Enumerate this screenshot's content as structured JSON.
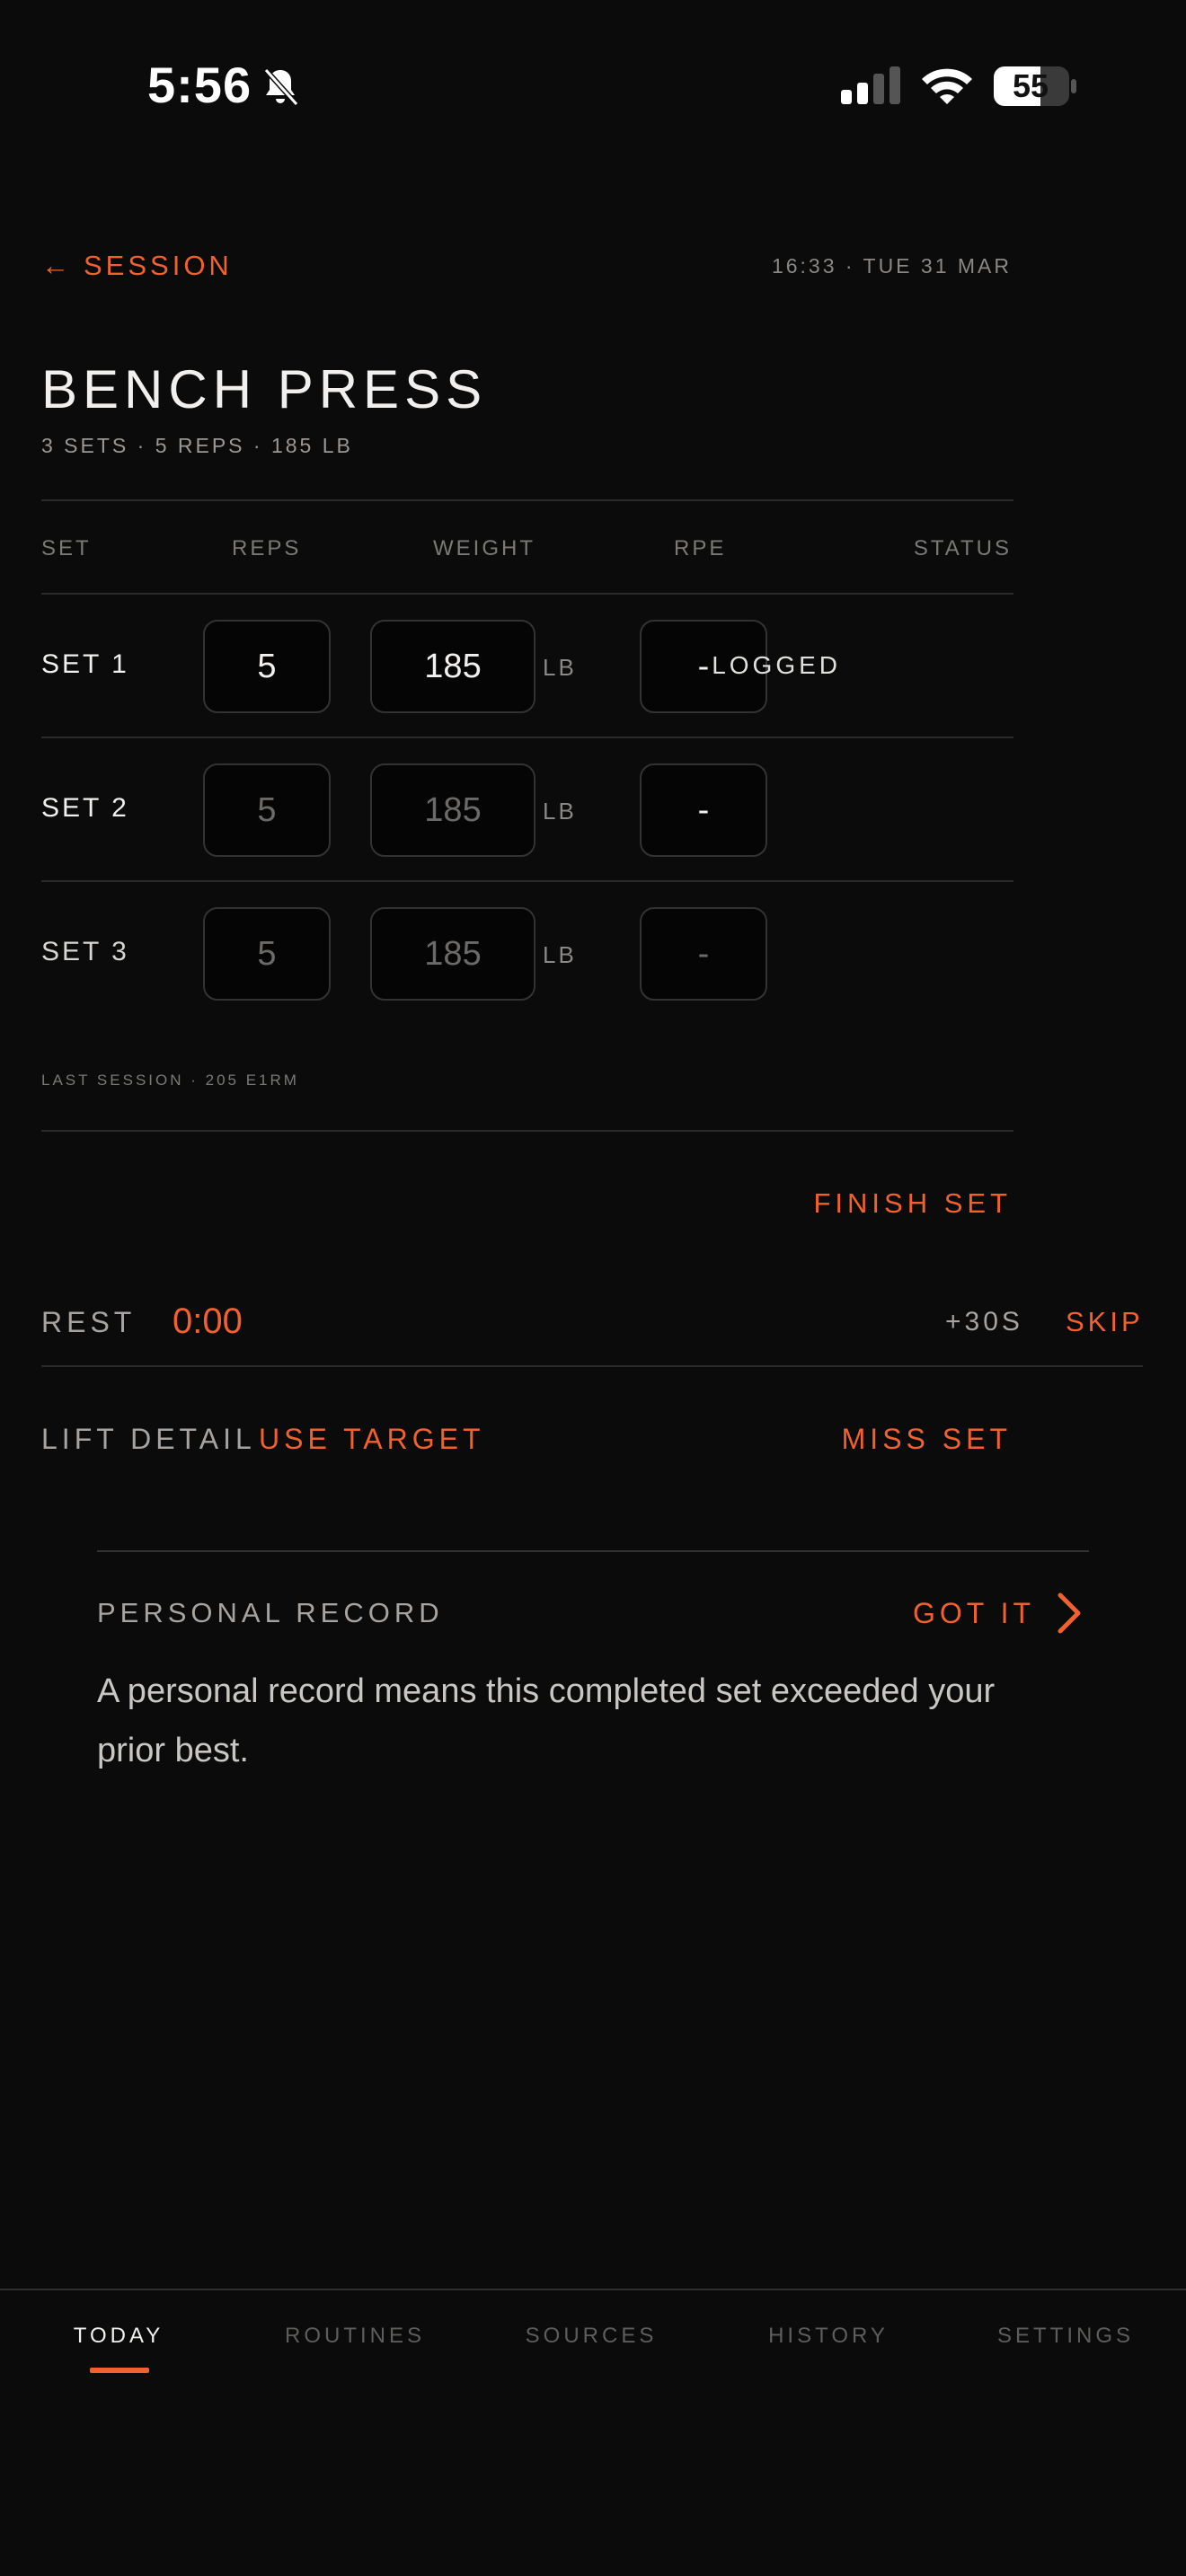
{
  "status_bar": {
    "time": "5:56",
    "battery": "55"
  },
  "header": {
    "back_label": "SESSION",
    "datetime": "16:33 · TUE 31 MAR"
  },
  "exercise": {
    "title": "BENCH PRESS",
    "subtitle": "3 SETS · 5 REPS · 185 LB"
  },
  "table": {
    "columns": [
      "SET",
      "REPS",
      "WEIGHT",
      "RPE",
      "STATUS"
    ],
    "rows": [
      {
        "label": "SET 1",
        "reps": "5",
        "weight": "185",
        "unit": "LB",
        "rpe": "-",
        "status": "LOGGED"
      },
      {
        "label": "SET 2",
        "reps": "5",
        "weight": "185",
        "unit": "LB",
        "rpe": "-",
        "status": ""
      },
      {
        "label": "SET 3",
        "reps": "5",
        "weight": "185",
        "unit": "LB",
        "rpe": "-",
        "status": ""
      }
    ],
    "last_session": "LAST SESSION · 205 E1RM"
  },
  "actions": {
    "finish_set": "FINISH SET"
  },
  "rest": {
    "label": "REST",
    "time": "0:00",
    "add": "+30S",
    "skip": "SKIP"
  },
  "lift_detail": {
    "label": "LIFT DETAIL",
    "use_target": "USE TARGET",
    "miss_set": "MISS SET"
  },
  "personal_record": {
    "label": "PERSONAL RECORD",
    "dismiss": "GOT IT",
    "text": "A personal record means this completed set exceeded your prior best."
  },
  "nav": {
    "items": [
      "TODAY",
      "ROUTINES",
      "SOURCES",
      "HISTORY",
      "SETTINGS"
    ],
    "active": "TODAY"
  },
  "colors": {
    "accent": "#f0612f",
    "background": "#0b0b0b"
  }
}
